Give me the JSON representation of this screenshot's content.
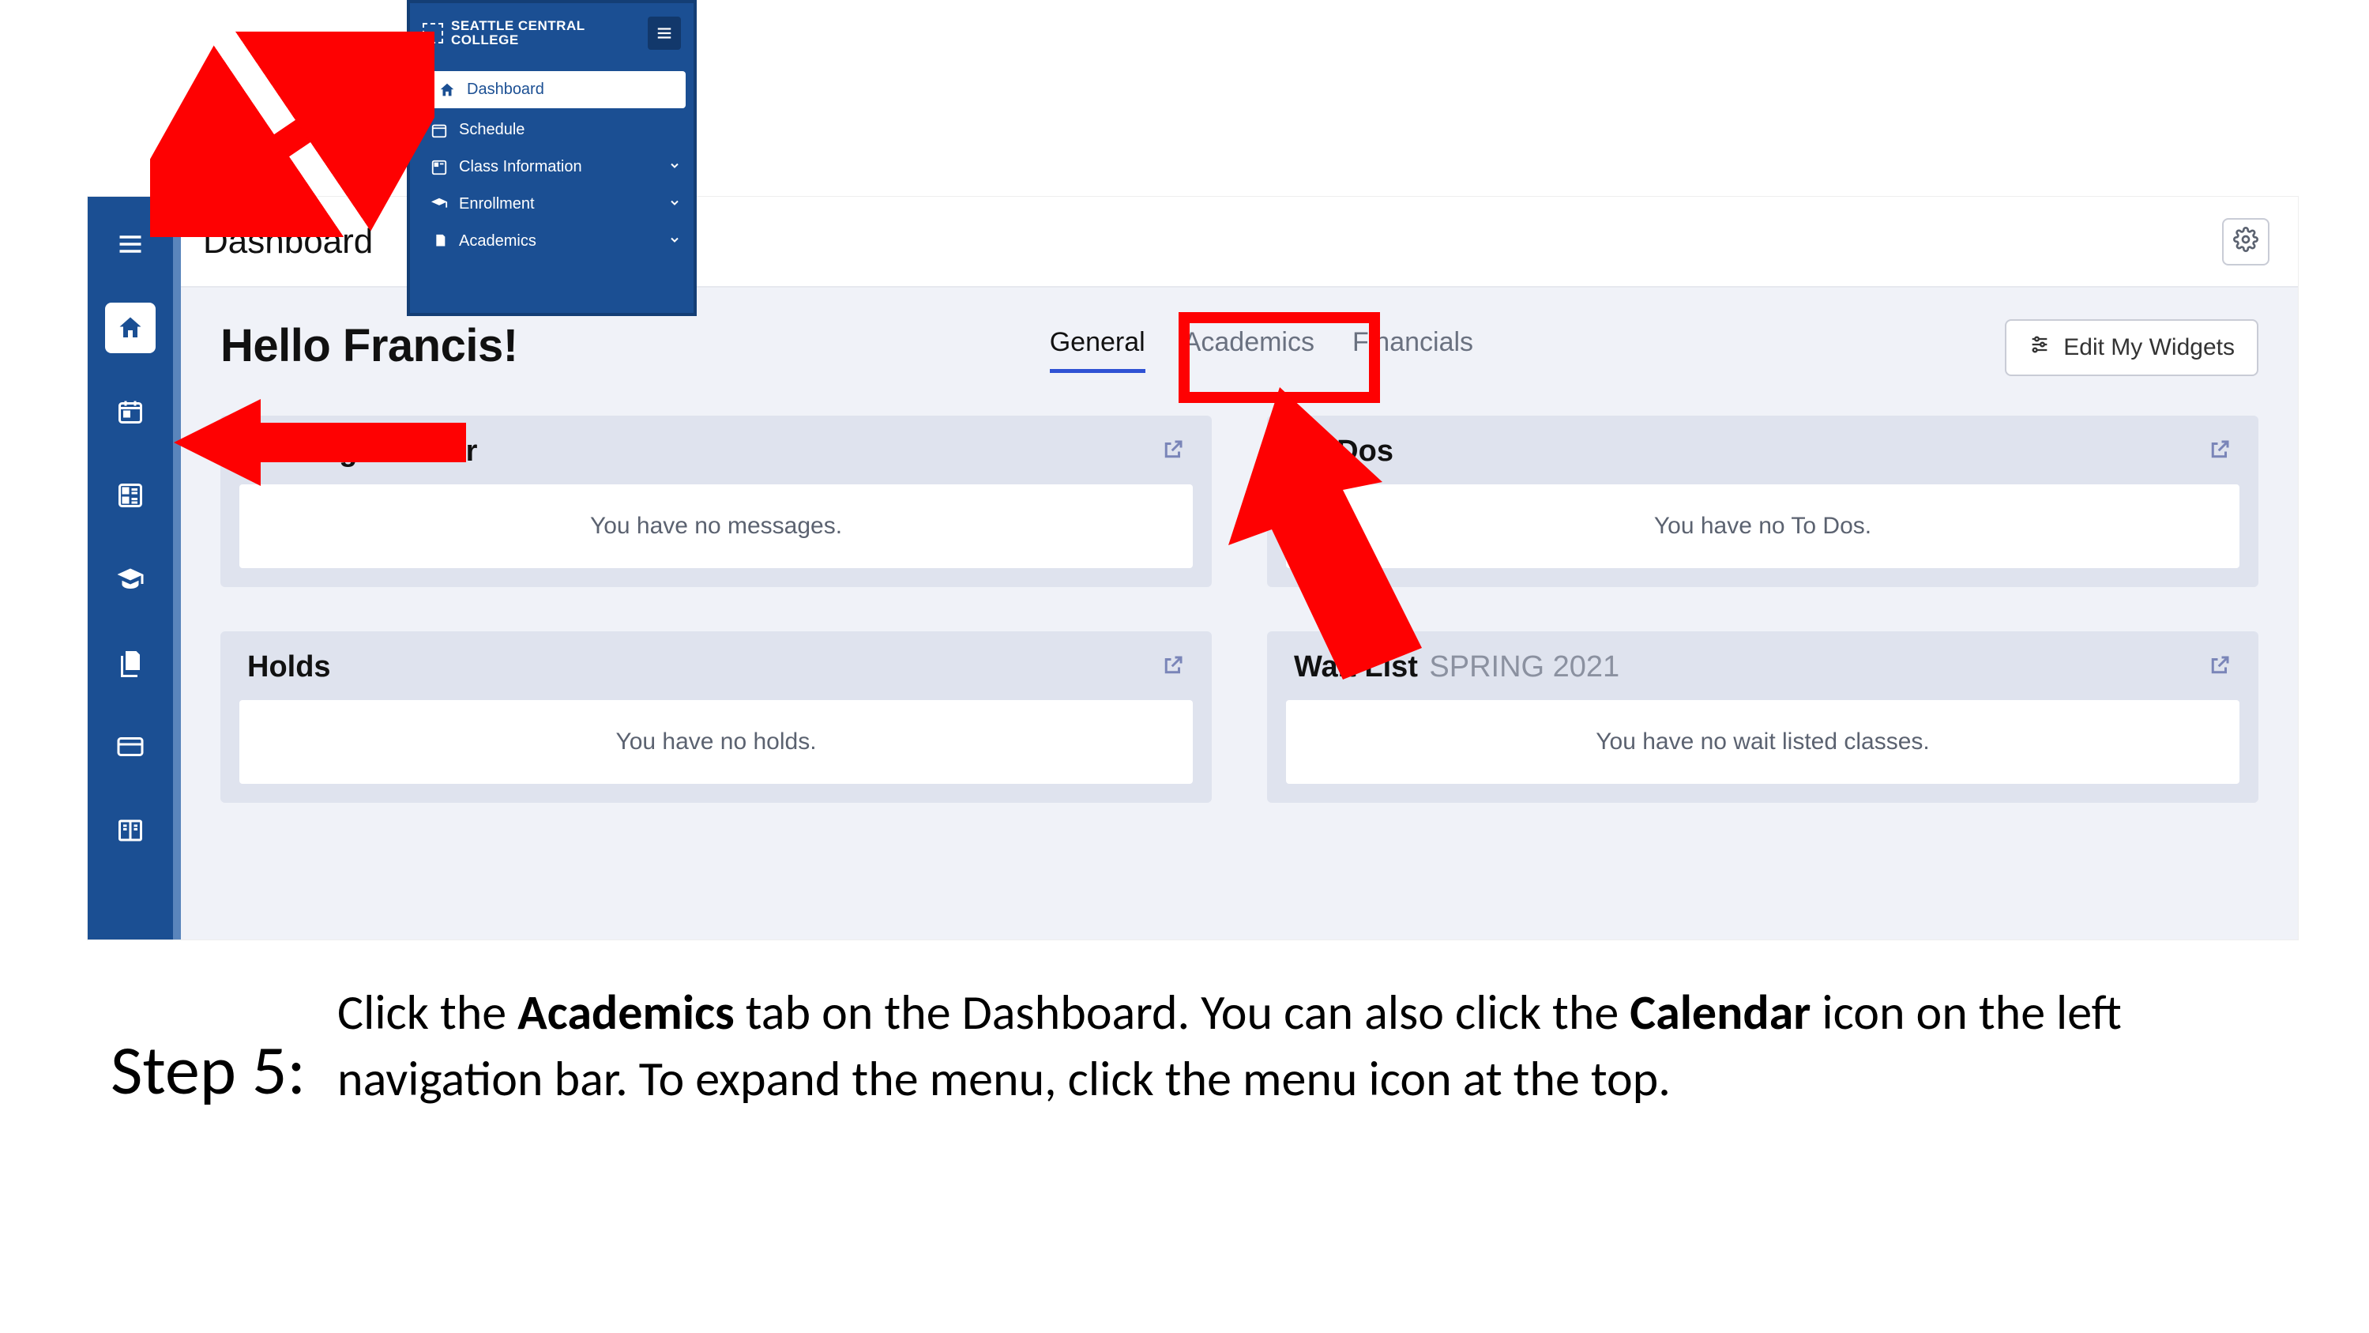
{
  "page_title": "Dashboard",
  "greeting": "Hello Francis!",
  "tabs": {
    "general": "General",
    "academics": "Academics",
    "financials": "Financials"
  },
  "edit_widgets_label": "Edit My Widgets",
  "widgets": {
    "message_center": {
      "title": "Message Center",
      "body": "You have no messages."
    },
    "to_dos": {
      "title": "To Dos",
      "body": "You have no To Dos."
    },
    "holds": {
      "title": "Holds",
      "body": "You have no holds."
    },
    "wait_list": {
      "title": "Wait List",
      "subtitle": "SPRING 2021",
      "body": "You have no wait listed classes."
    }
  },
  "inset_menu": {
    "brand_line1": "SEATTLE CENTRAL",
    "brand_line2": "COLLEGE",
    "items": {
      "dashboard": "Dashboard",
      "schedule": "Schedule",
      "class_info": "Class Information",
      "enrollment": "Enrollment",
      "academics": "Academics"
    }
  },
  "instruction": {
    "step_label": "Step 5:",
    "pre1": "Click the ",
    "bold1": "Academics",
    "mid1": " tab on the Dashboard. You can also click the ",
    "bold2": "Calendar",
    "post1": " icon on the left navigation bar.  To expand the menu, click the menu icon at the top."
  }
}
